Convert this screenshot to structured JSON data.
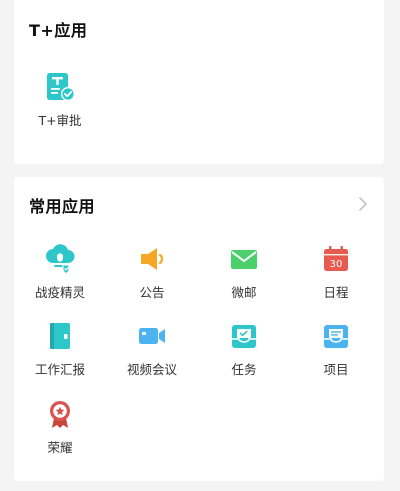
{
  "tplus": {
    "title": "T+应用",
    "apps": [
      {
        "label": "T+审批",
        "icon": "approval-document-icon"
      }
    ]
  },
  "common": {
    "title": "常用应用",
    "more_icon": "chevron-right-icon",
    "apps": [
      {
        "label": "战疫精灵",
        "icon": "epidemic-shield-icon"
      },
      {
        "label": "公告",
        "icon": "speaker-icon"
      },
      {
        "label": "微邮",
        "icon": "mail-icon"
      },
      {
        "label": "日程",
        "icon": "calendar-icon",
        "badge": "30"
      },
      {
        "label": "工作汇报",
        "icon": "report-book-icon"
      },
      {
        "label": "视频会议",
        "icon": "video-camera-icon"
      },
      {
        "label": "任务",
        "icon": "task-box-icon"
      },
      {
        "label": "项目",
        "icon": "project-box-icon"
      },
      {
        "label": "荣耀",
        "icon": "medal-icon"
      }
    ]
  },
  "colors": {
    "teal": "#2ec7c9",
    "orange": "#f5a623",
    "green": "#4cd06b",
    "red": "#e85a4f",
    "blue": "#4ab3f0",
    "medal": "#d9534f"
  }
}
